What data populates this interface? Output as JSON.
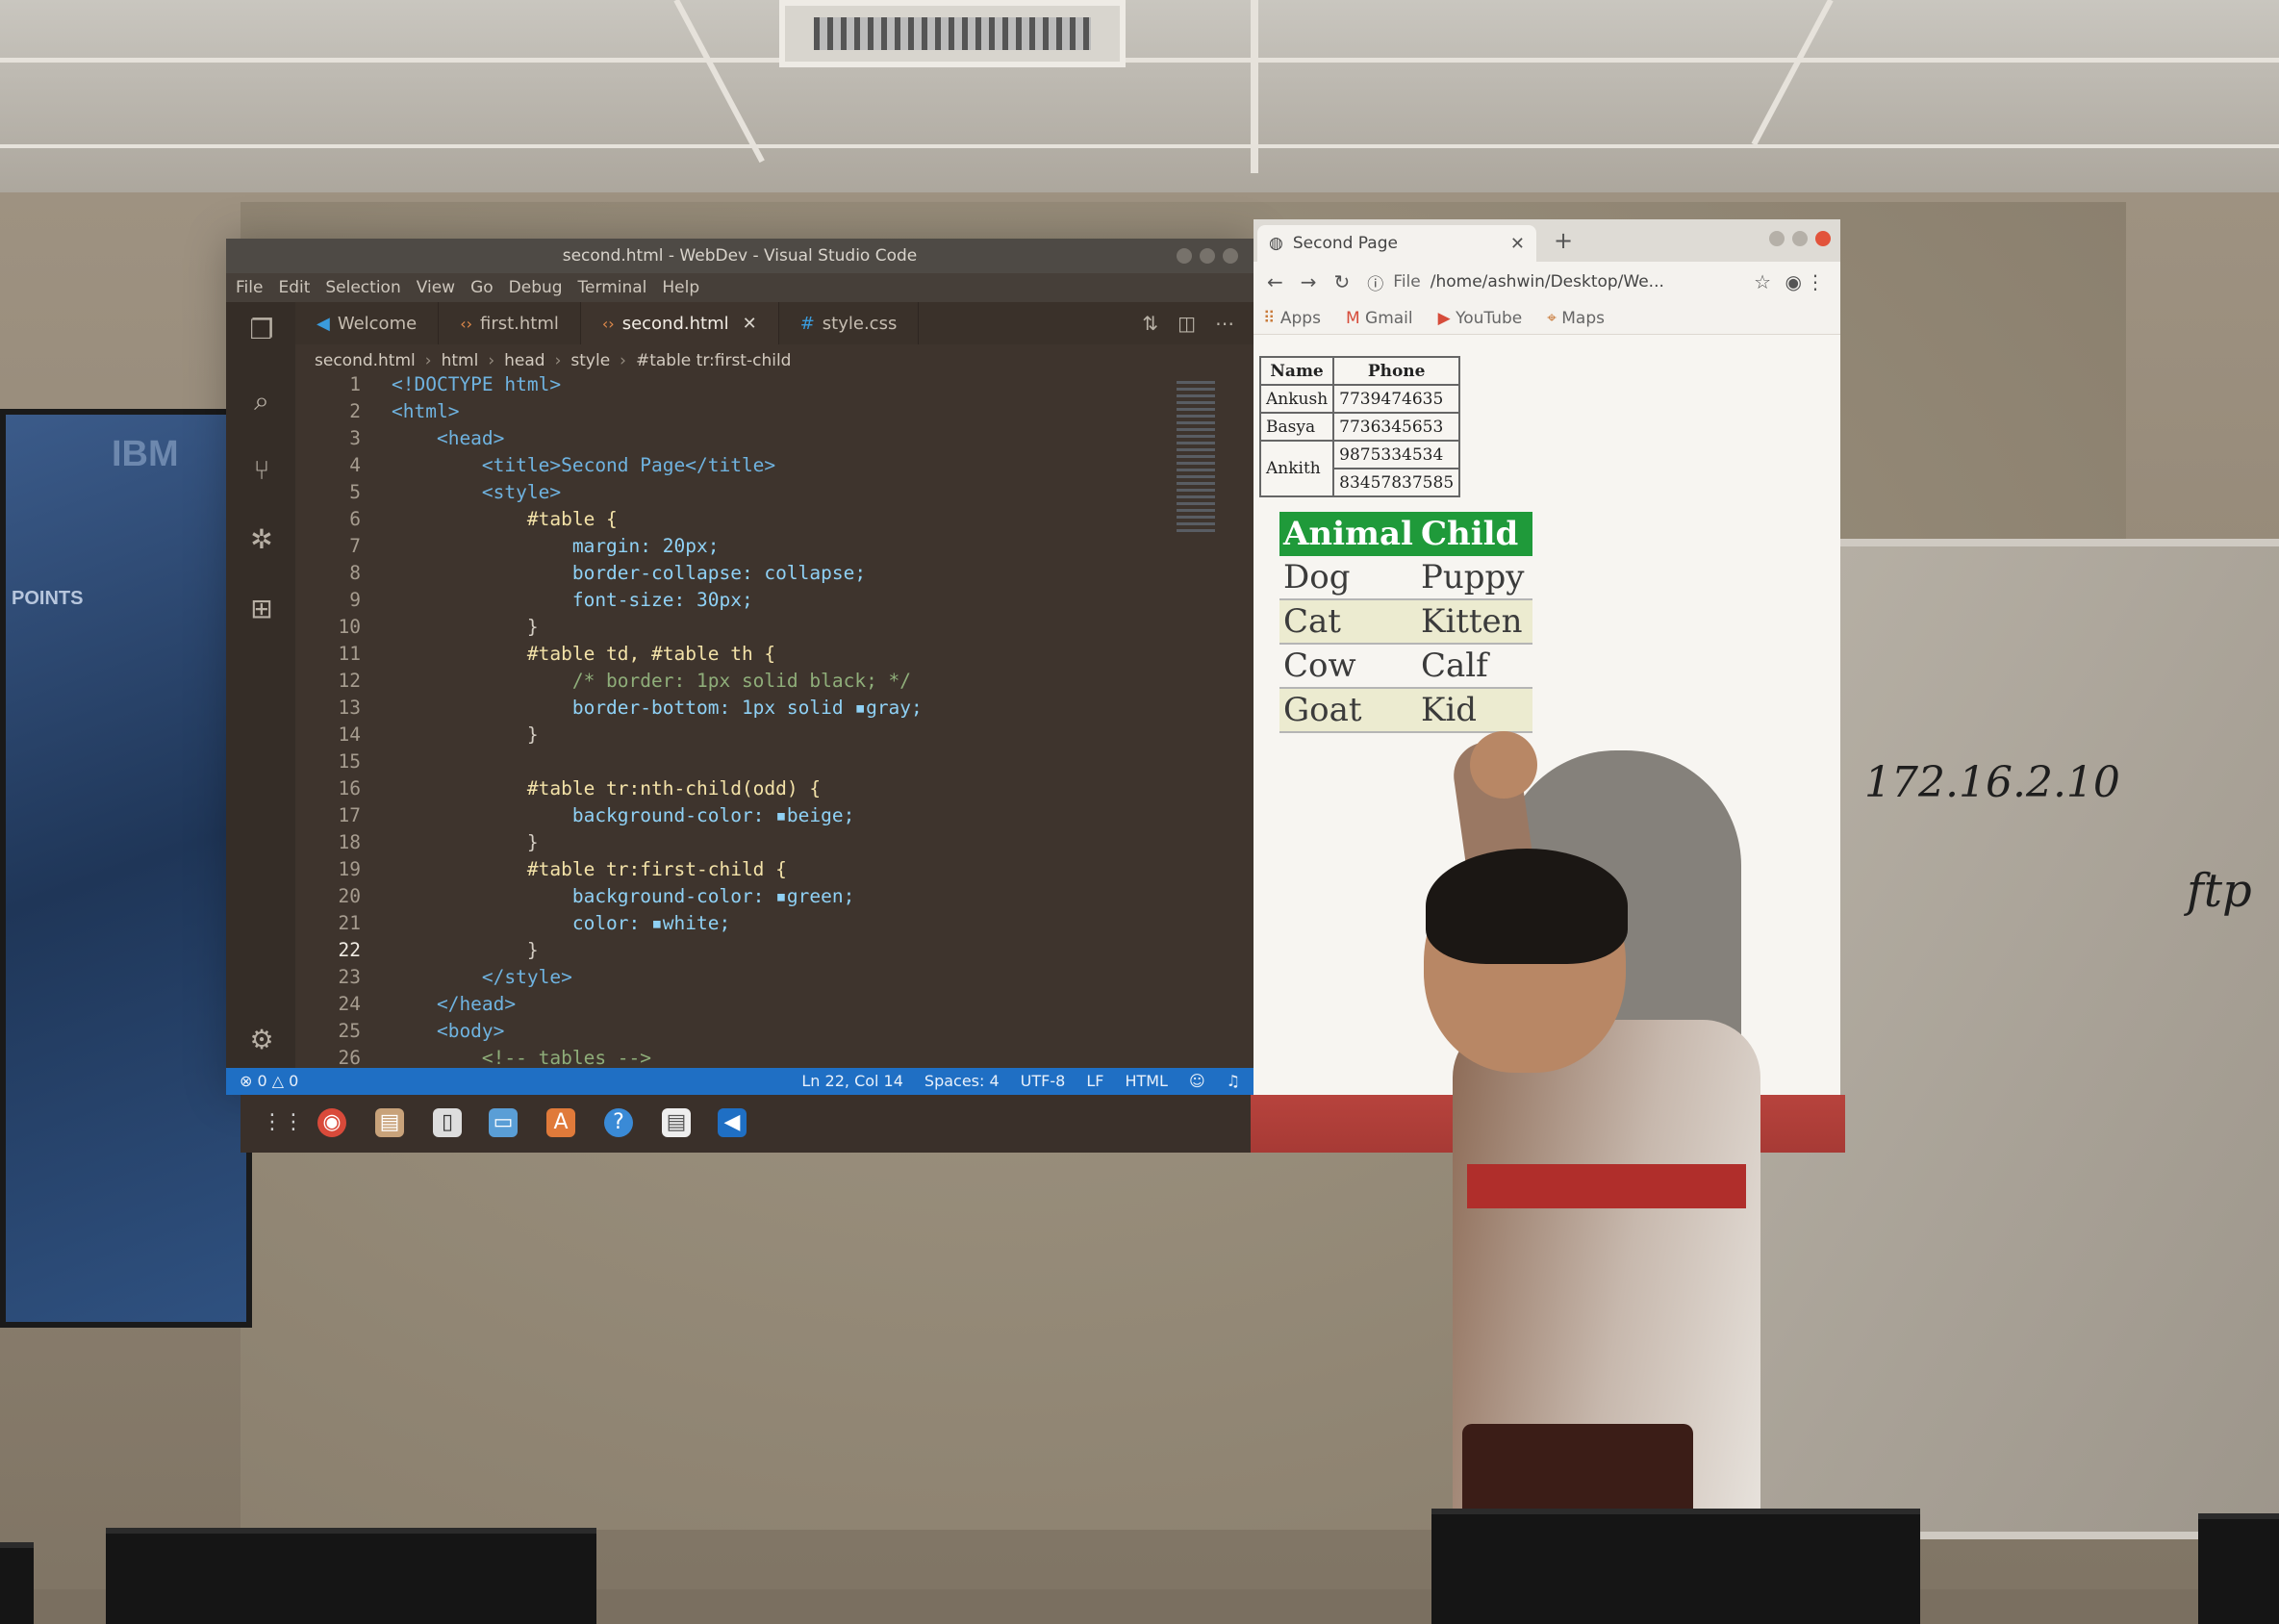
{
  "vscode": {
    "title": "second.html - WebDev - Visual Studio Code",
    "menu": [
      "File",
      "Edit",
      "Selection",
      "View",
      "Go",
      "Debug",
      "Terminal",
      "Help"
    ],
    "tabs": [
      {
        "label": "Welcome",
        "icon": "vscode-icon"
      },
      {
        "label": "first.html",
        "icon": "html-icon"
      },
      {
        "label": "second.html",
        "icon": "html-icon",
        "active": true
      },
      {
        "label": "style.css",
        "icon": "css-icon"
      }
    ],
    "breadcrumb": [
      "second.html",
      "html",
      "head",
      "style",
      "#table tr:first-child"
    ],
    "code_lines": [
      {
        "n": "1",
        "text": "<!DOCTYPE html>"
      },
      {
        "n": "2",
        "text": "<html>"
      },
      {
        "n": "3",
        "text": "    <head>"
      },
      {
        "n": "4",
        "text": "        <title>Second Page</title>"
      },
      {
        "n": "5",
        "text": "        <style>"
      },
      {
        "n": "6",
        "text": "            #table {"
      },
      {
        "n": "7",
        "text": "                margin: 20px;"
      },
      {
        "n": "8",
        "text": "                border-collapse: collapse;"
      },
      {
        "n": "9",
        "text": "                font-size: 30px;"
      },
      {
        "n": "10",
        "text": "            }"
      },
      {
        "n": "11",
        "text": "            #table td, #table th {"
      },
      {
        "n": "12",
        "text": "                /* border: 1px solid black; */"
      },
      {
        "n": "13",
        "text": "                border-bottom: 1px solid ▪gray;"
      },
      {
        "n": "14",
        "text": "            }"
      },
      {
        "n": "15",
        "text": ""
      },
      {
        "n": "16",
        "text": "            #table tr:nth-child(odd) {"
      },
      {
        "n": "17",
        "text": "                background-color: ▪beige;"
      },
      {
        "n": "18",
        "text": "            }"
      },
      {
        "n": "19",
        "text": "            #table tr:first-child {"
      },
      {
        "n": "20",
        "text": "                background-color: ▪green;"
      },
      {
        "n": "21",
        "text": "                color: ▪white;"
      },
      {
        "n": "22",
        "text": "            }"
      },
      {
        "n": "23",
        "text": "        </style>"
      },
      {
        "n": "24",
        "text": "    </head>"
      },
      {
        "n": "25",
        "text": "    <body>"
      },
      {
        "n": "26",
        "text": "        <!-- tables -->"
      }
    ],
    "status": {
      "problems": "⊗ 0 △ 0",
      "position": "Ln 22, Col 14",
      "spaces": "Spaces: 4",
      "encoding": "UTF-8",
      "eol": "LF",
      "language": "HTML"
    },
    "colors": {
      "statusbar": "#1f6fc4",
      "editor_bg": "#3e342d"
    }
  },
  "chrome": {
    "tab_title": "Second Page",
    "new_tab": "+",
    "url_prefix": "File",
    "url": "/home/ashwin/Desktop/We...",
    "bookmarks": [
      "Apps",
      "Gmail",
      "YouTube",
      "Maps"
    ],
    "contacts": {
      "headers": [
        "Name",
        "Phone"
      ],
      "rows": [
        {
          "name": "Ankush",
          "phones": [
            "7739474635"
          ]
        },
        {
          "name": "Basya",
          "phones": [
            "7736345653"
          ]
        },
        {
          "name": "Ankith",
          "phones": [
            "9875334534",
            "83457837585"
          ]
        }
      ]
    },
    "animals": {
      "headers": [
        "Animal",
        "Child"
      ],
      "rows": [
        [
          "Dog",
          "Puppy"
        ],
        [
          "Cat",
          "Kitten"
        ],
        [
          "Cow",
          "Calf"
        ],
        [
          "Goat",
          "Kid"
        ]
      ],
      "header_color": "#1f9a3a",
      "odd_row_color": "beige"
    }
  },
  "whiteboard": {
    "ip_text": "172.16.2.10",
    "side_text": "ftp"
  },
  "poster": {
    "logo": "IBM",
    "text": "POINTS"
  },
  "taskbar": {
    "icons": [
      "apps-grid-icon",
      "chrome-icon",
      "files-icon",
      "terminal-icon",
      "text-editor-icon",
      "software-icon",
      "help-icon",
      "document-icon",
      "vscode-icon"
    ]
  }
}
